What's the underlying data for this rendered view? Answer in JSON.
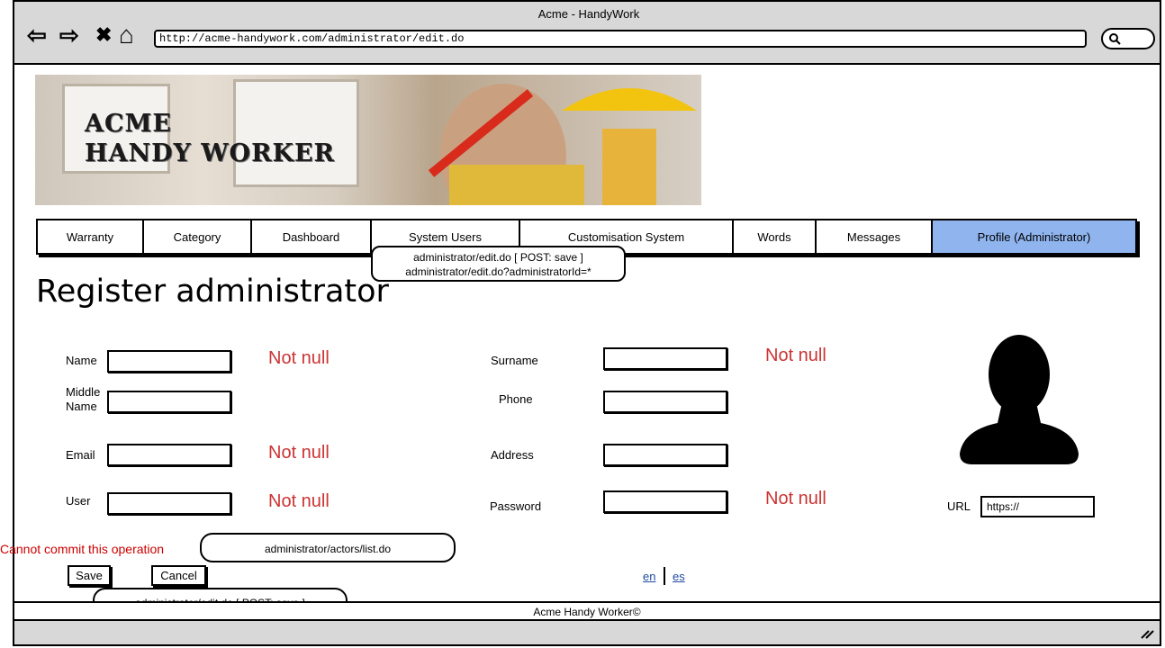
{
  "window": {
    "title": "Acme - HandyWork"
  },
  "browser": {
    "url": "http://acme-handywork.com/administrator/edit.do",
    "back_glyph": "⇦",
    "forward_glyph": "⇨",
    "stop_glyph": "✖",
    "home_glyph": "⌂"
  },
  "banner": {
    "line1": "ACME",
    "line2": "HANDY WORKER"
  },
  "nav": {
    "tabs": [
      {
        "label": "Warranty"
      },
      {
        "label": "Category"
      },
      {
        "label": "Dashboard"
      },
      {
        "label": "System Users"
      },
      {
        "label": "Customisation System"
      },
      {
        "label": "Words"
      },
      {
        "label": "Messages"
      },
      {
        "label": "Profile (Administrator)",
        "active": true
      }
    ]
  },
  "callouts": {
    "edit_line1": "administrator/edit.do [ POST: save ]",
    "edit_line2": "administrator/edit.do?administratorId=*",
    "cancel": "administrator/actors/list.do",
    "save": "administrator/edit.do [ POST: save ]"
  },
  "page": {
    "title": "Register administrator"
  },
  "form": {
    "name_label": "Name",
    "middle_label_1": "Middle",
    "middle_label_2": "Name",
    "email_label": "Email",
    "user_label": "User",
    "surname_label": "Surname",
    "phone_label": "Phone",
    "address_label": "Address",
    "password_label": "Password",
    "url_label": "URL",
    "url_value": "https://",
    "not_null": "Not null"
  },
  "actions": {
    "error": "Cannot commit this operation",
    "save": "Save",
    "cancel": "Cancel"
  },
  "languages": {
    "en": "en",
    "es": "es"
  },
  "footer": {
    "text": "Acme Handy Worker©"
  },
  "colors": {
    "active_tab": "#8fb4ee",
    "error": "#cc0000",
    "required": "#cc3333",
    "link": "#1f4aa0"
  }
}
